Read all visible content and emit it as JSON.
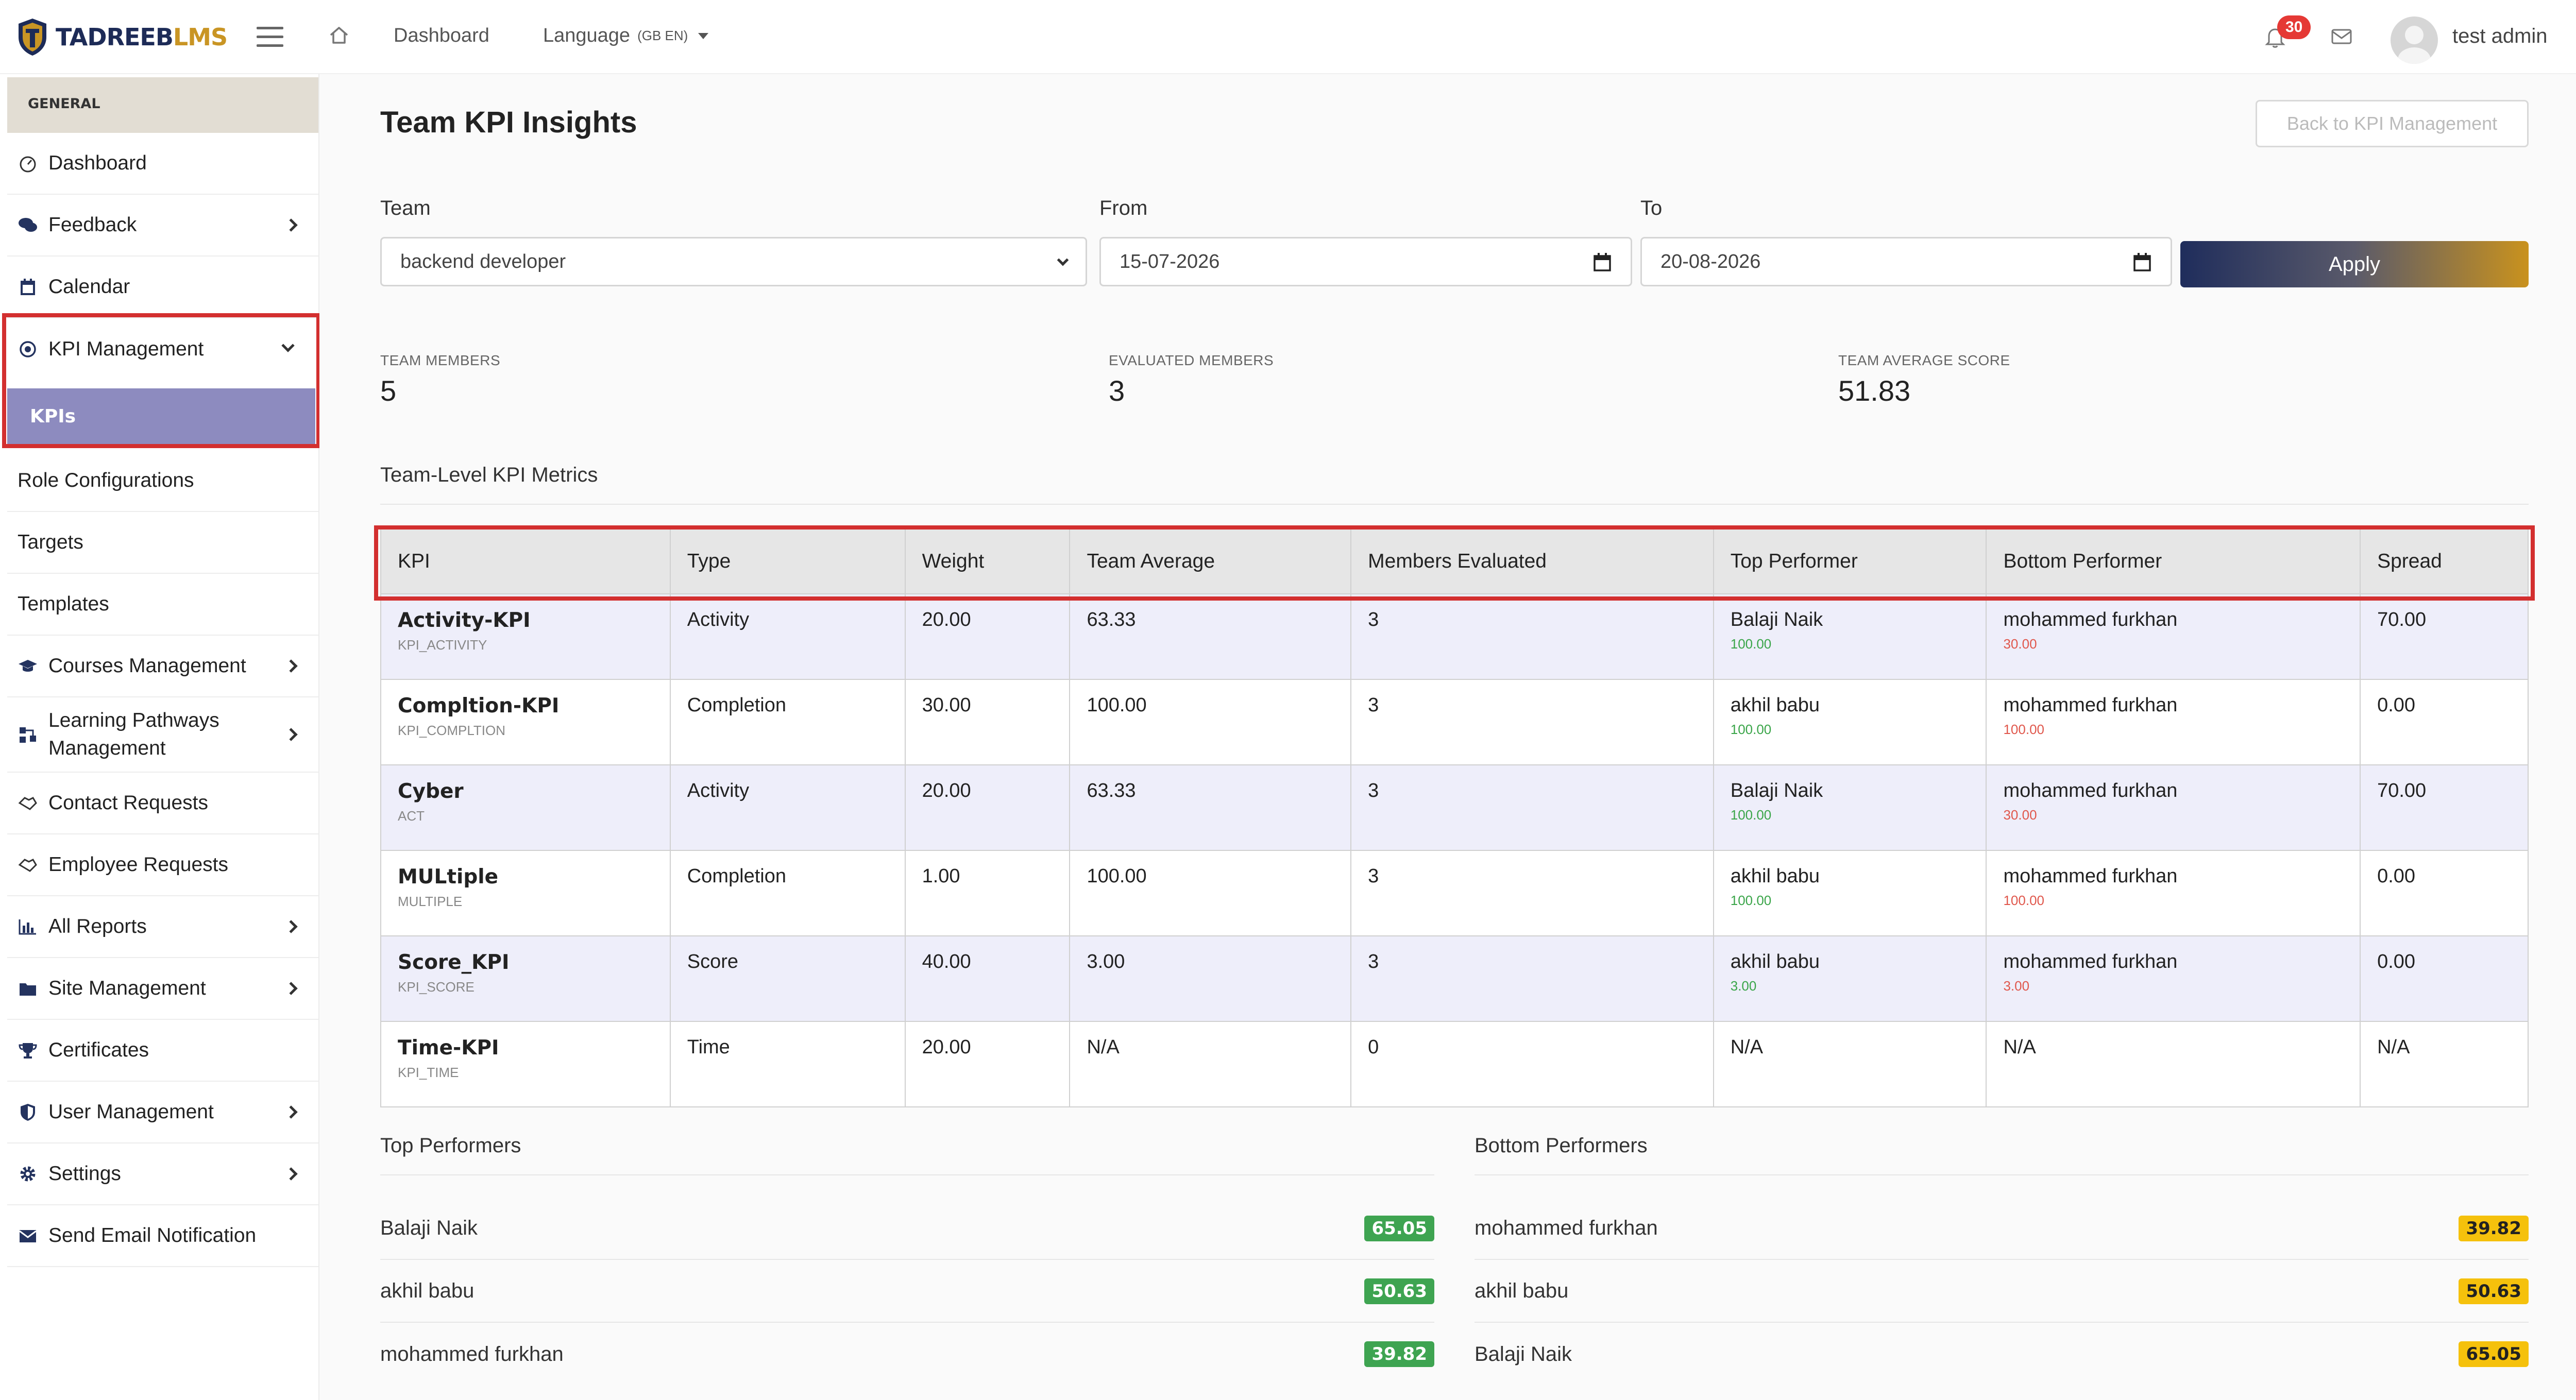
{
  "brand": {
    "name_main": "TADREEB",
    "name_accent": "LMS"
  },
  "topnav": {
    "dashboard": "Dashboard",
    "language": "Language",
    "language_code": "(GB EN)",
    "notification_count": "30",
    "user_name": "test admin"
  },
  "sidebar": {
    "section": "GENERAL",
    "items": [
      {
        "label": "Dashboard"
      },
      {
        "label": "Feedback"
      },
      {
        "label": "Calendar"
      },
      {
        "label": "KPI Management"
      },
      {
        "label": "KPIs"
      },
      {
        "label": "Role Configurations"
      },
      {
        "label": "Targets"
      },
      {
        "label": "Templates"
      },
      {
        "label": "Courses Management"
      },
      {
        "label": "Learning Pathways",
        "label2": "Management"
      },
      {
        "label": "Contact Requests"
      },
      {
        "label": "Employee Requests"
      },
      {
        "label": "All Reports"
      },
      {
        "label": "Site Management"
      },
      {
        "label": "Certificates"
      },
      {
        "label": "User Management"
      },
      {
        "label": "Settings"
      },
      {
        "label": "Send Email Notification"
      }
    ]
  },
  "page": {
    "title": "Team KPI Insights",
    "back_button": "Back to KPI Management"
  },
  "filters": {
    "team_label": "Team",
    "team_value": "backend developer",
    "from_label": "From",
    "from_value": "15-07-2026",
    "to_label": "To",
    "to_value": "20-08-2026",
    "apply": "Apply"
  },
  "stats": {
    "team_members_label": "TEAM MEMBERS",
    "team_members_value": "5",
    "evaluated_label": "EVALUATED MEMBERS",
    "evaluated_value": "3",
    "average_label": "TEAM AVERAGE SCORE",
    "average_value": "51.83"
  },
  "metrics": {
    "title": "Team-Level KPI Metrics",
    "headers": [
      "KPI",
      "Type",
      "Weight",
      "Team Average",
      "Members Evaluated",
      "Top Performer",
      "Bottom Performer",
      "Spread"
    ],
    "rows": [
      {
        "name": "Activity-KPI",
        "code": "KPI_ACTIVITY",
        "type": "Activity",
        "weight": "20.00",
        "average": "63.33",
        "evaluated": "3",
        "top_name": "Balaji Naik",
        "top_score": "100.00",
        "bottom_name": "mohammed furkhan",
        "bottom_score": "30.00",
        "spread": "70.00"
      },
      {
        "name": "Compltion-KPI",
        "code": "KPI_COMPLTION",
        "type": "Completion",
        "weight": "30.00",
        "average": "100.00",
        "evaluated": "3",
        "top_name": "akhil babu",
        "top_score": "100.00",
        "bottom_name": "mohammed furkhan",
        "bottom_score": "100.00",
        "spread": "0.00"
      },
      {
        "name": "Cyber",
        "code": "ACT",
        "type": "Activity",
        "weight": "20.00",
        "average": "63.33",
        "evaluated": "3",
        "top_name": "Balaji Naik",
        "top_score": "100.00",
        "bottom_name": "mohammed furkhan",
        "bottom_score": "30.00",
        "spread": "70.00"
      },
      {
        "name": "MULtiple",
        "code": "MULTIPLE",
        "type": "Completion",
        "weight": "1.00",
        "average": "100.00",
        "evaluated": "3",
        "top_name": "akhil babu",
        "top_score": "100.00",
        "bottom_name": "mohammed furkhan",
        "bottom_score": "100.00",
        "spread": "0.00"
      },
      {
        "name": "Score_KPI",
        "code": "KPI_SCORE",
        "type": "Score",
        "weight": "40.00",
        "average": "3.00",
        "evaluated": "3",
        "top_name": "akhil babu",
        "top_score": "3.00",
        "bottom_name": "mohammed furkhan",
        "bottom_score": "3.00",
        "spread": "0.00"
      },
      {
        "name": "Time-KPI",
        "code": "KPI_TIME",
        "type": "Time",
        "weight": "20.00",
        "average": "N/A",
        "evaluated": "0",
        "top_name": "N/A",
        "top_score": "",
        "bottom_name": "N/A",
        "bottom_score": "",
        "spread": "N/A"
      }
    ]
  },
  "top_performers": {
    "title": "Top Performers",
    "rows": [
      {
        "name": "Balaji Naik",
        "score": "65.05"
      },
      {
        "name": "akhil babu",
        "score": "50.63"
      },
      {
        "name": "mohammed furkhan",
        "score": "39.82"
      }
    ]
  },
  "bottom_performers": {
    "title": "Bottom Performers",
    "rows": [
      {
        "name": "mohammed furkhan",
        "score": "39.82"
      },
      {
        "name": "akhil babu",
        "score": "50.63"
      },
      {
        "name": "Balaji Naik",
        "score": "65.05"
      }
    ]
  },
  "colors": {
    "accent_navy": "#1f2d5c",
    "accent_gold": "#c9921e",
    "highlight_red": "#d32f2f",
    "kpis_active": "#8d8bbf",
    "score_green": "#3ea451",
    "score_yellow": "#f5c10c"
  },
  "icons": {
    "hamburger": "hamburger-icon",
    "home": "home-icon",
    "bell": "bell-icon",
    "mail": "mail-icon",
    "calendar_picker": "calendar-icon"
  }
}
